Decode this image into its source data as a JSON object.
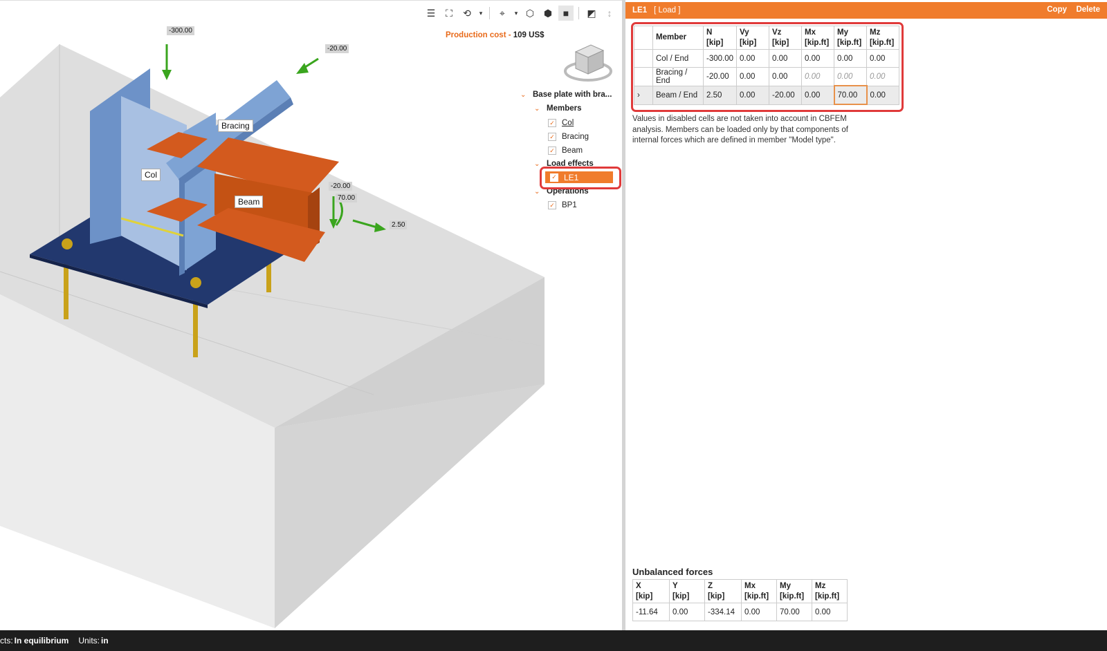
{
  "viewport": {
    "toolbar": {
      "icons": [
        "ruler-icon",
        "fit-view-icon",
        "rotate-icon",
        "crop-icon",
        "wireframe-icon",
        "transparent-icon",
        "solid-icon",
        "section-icon",
        "mirror-icon",
        "home-icon"
      ]
    },
    "production_cost": {
      "label": "Production cost",
      "separator": " - ",
      "value": "109 US$"
    },
    "labels3d": {
      "col": "Col",
      "bracing": "Bracing",
      "beam": "Beam"
    },
    "load_values": {
      "col_n": "-300.00",
      "bracing_n": "-20.00",
      "beam_vz": "-20.00",
      "beam_my": "70.00",
      "beam_n": "2.50"
    },
    "tree": {
      "root": "Base plate with bra...",
      "members_label": "Members",
      "members": [
        "Col",
        "Bracing",
        "Beam"
      ],
      "load_effects_label": "Load effects",
      "load_effects": [
        "LE1"
      ],
      "operations_label": "Operations",
      "operations": [
        "BP1"
      ]
    }
  },
  "panel": {
    "header": {
      "name": "LE1",
      "type": "[ Load ]",
      "copy": "Copy",
      "delete": "Delete"
    },
    "loads_table": {
      "headers": [
        {
          "name": "Member",
          "unit": ""
        },
        {
          "name": "N",
          "unit": "[kip]"
        },
        {
          "name": "Vy",
          "unit": "[kip]"
        },
        {
          "name": "Vz",
          "unit": "[kip]"
        },
        {
          "name": "Mx",
          "unit": "[kip.ft]"
        },
        {
          "name": "My",
          "unit": "[kip.ft]"
        },
        {
          "name": "Mz",
          "unit": "[kip.ft]"
        }
      ],
      "rows": [
        {
          "member": "Col / End",
          "values": [
            "-300.00",
            "0.00",
            "0.00",
            "0.00",
            "0.00",
            "0.00"
          ]
        },
        {
          "member": "Bracing / End",
          "values": [
            "-20.00",
            "0.00",
            "0.00",
            "0.00",
            "0.00",
            "0.00"
          ]
        },
        {
          "member": "Beam / End",
          "values": [
            "2.50",
            "0.00",
            "-20.00",
            "0.00",
            "70.00",
            "0.00"
          ]
        }
      ]
    },
    "note": "Values in disabled cells are not taken into account in CBFEM analysis. Members can be loaded only by that components of internal forces which are defined in member \"Model type\".",
    "unbalanced": {
      "title": "Unbalanced forces",
      "headers": [
        {
          "name": "X",
          "unit": "[kip]"
        },
        {
          "name": "Y",
          "unit": "[kip]"
        },
        {
          "name": "Z",
          "unit": "[kip]"
        },
        {
          "name": "Mx",
          "unit": "[kip.ft]"
        },
        {
          "name": "My",
          "unit": "[kip.ft]"
        },
        {
          "name": "Mz",
          "unit": "[kip.ft]"
        }
      ],
      "values": [
        "-11.64",
        "0.00",
        "-334.14",
        "0.00",
        "70.00",
        "0.00"
      ]
    }
  },
  "status": {
    "effects_label": "cts:",
    "effects_value": "In equilibrium",
    "units_label": "Units:",
    "units_value": "in"
  },
  "colors": {
    "accent": "#f07c2c",
    "highlight": "#e03a3a",
    "steel": "#7ea3d4",
    "beam": "#d35a1e",
    "plate": "#22386e",
    "bolt": "#c9a21a"
  }
}
